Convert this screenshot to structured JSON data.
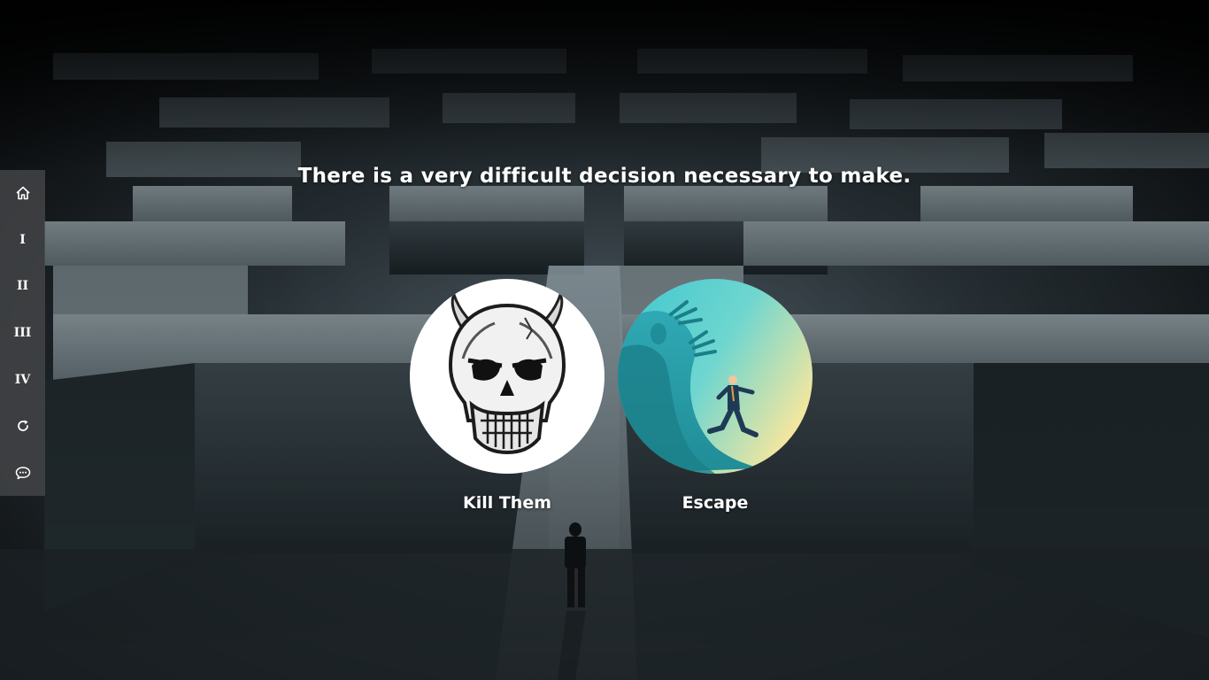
{
  "scene": {
    "prompt": "There is a very difficult decision necessary to make."
  },
  "sidebar": {
    "items": [
      {
        "label": "",
        "icon": "home-icon"
      },
      {
        "label": "I"
      },
      {
        "label": "II"
      },
      {
        "label": "III"
      },
      {
        "label": "IV"
      },
      {
        "label": "",
        "icon": "refresh-icon"
      },
      {
        "label": "",
        "icon": "chat-icon"
      }
    ]
  },
  "choices": [
    {
      "label": "Kill Them",
      "image": "skull-with-horns"
    },
    {
      "label": "Escape",
      "image": "man-running-from-wave-monster"
    }
  ],
  "colors": {
    "sidebar_bg": "#46484a",
    "text": "#ffffff",
    "escape_gradient_start": "#3fc6cf",
    "escape_gradient_end": "#f1e6a0"
  }
}
